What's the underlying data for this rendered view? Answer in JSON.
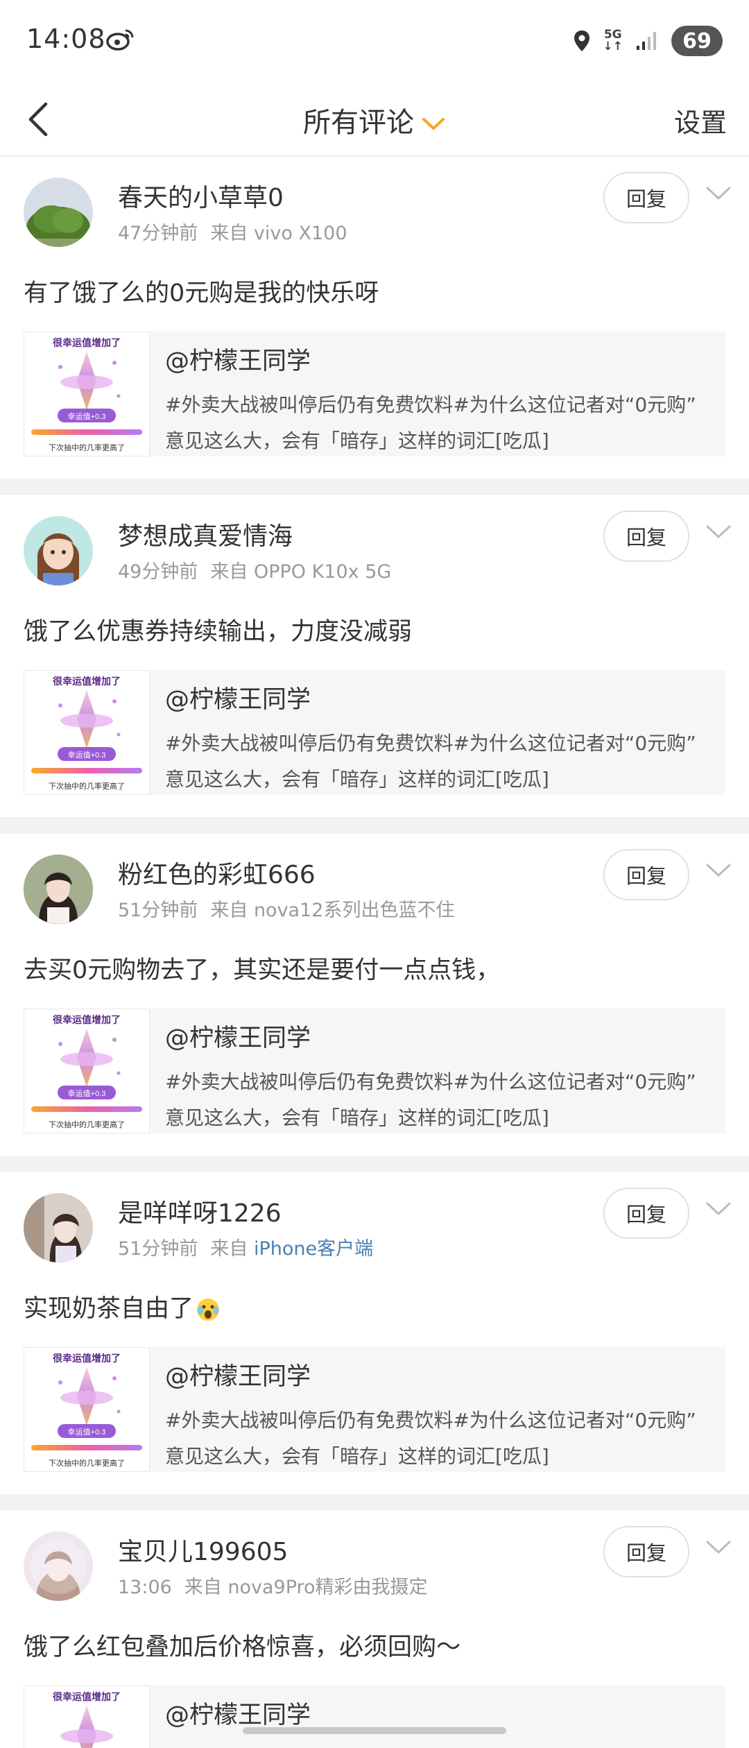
{
  "status": {
    "time": "14:08",
    "network": "5G",
    "battery": "69"
  },
  "nav": {
    "title": "所有评论",
    "settings": "设置"
  },
  "comments": [
    {
      "user": "春天的小草草0",
      "time": "47分钟前",
      "source": "来自 vivo X100",
      "text": "有了饿了么的0元购是我的快乐呀",
      "reply": "回复"
    },
    {
      "user": "梦想成真爱情海",
      "time": "49分钟前",
      "source": "来自 OPPO K10x 5G",
      "text": "饿了么优惠券持续输出，力度没减弱",
      "reply": "回复"
    },
    {
      "user": "粉红色的彩虹666",
      "time": "51分钟前",
      "source": "来自 nova12系列出色蓝不住",
      "text": "去买0元购物去了，其实还是要付一点点钱，",
      "reply": "回复"
    },
    {
      "user": "是咩咩呀1226",
      "time": "51分钟前",
      "source": "来自",
      "source_link": "iPhone客户端",
      "text": "实现奶茶自由了",
      "reply": "回复"
    },
    {
      "user": "宝贝儿199605",
      "time": "13:06",
      "source": "来自 nova9Pro精彩由我摄定",
      "text": "饿了么红包叠加后价格惊喜，必须回购～",
      "reply": "回复"
    }
  ],
  "quote": {
    "author": "@柠檬王同学",
    "line1": "#外卖大战被叫停后仍有免费饮料#为什么这位记者对“0元购”",
    "line2": "意见这么大，会有「暗存」这样的词汇[吃瓜]",
    "thumb_title": "很幸运值增加了",
    "thumb_badge": "幸运值+0.3",
    "thumb_caption": "下次抽中的几率更高了"
  },
  "colors": {
    "accent": "#f5a623",
    "link": "#4a7fb5"
  }
}
